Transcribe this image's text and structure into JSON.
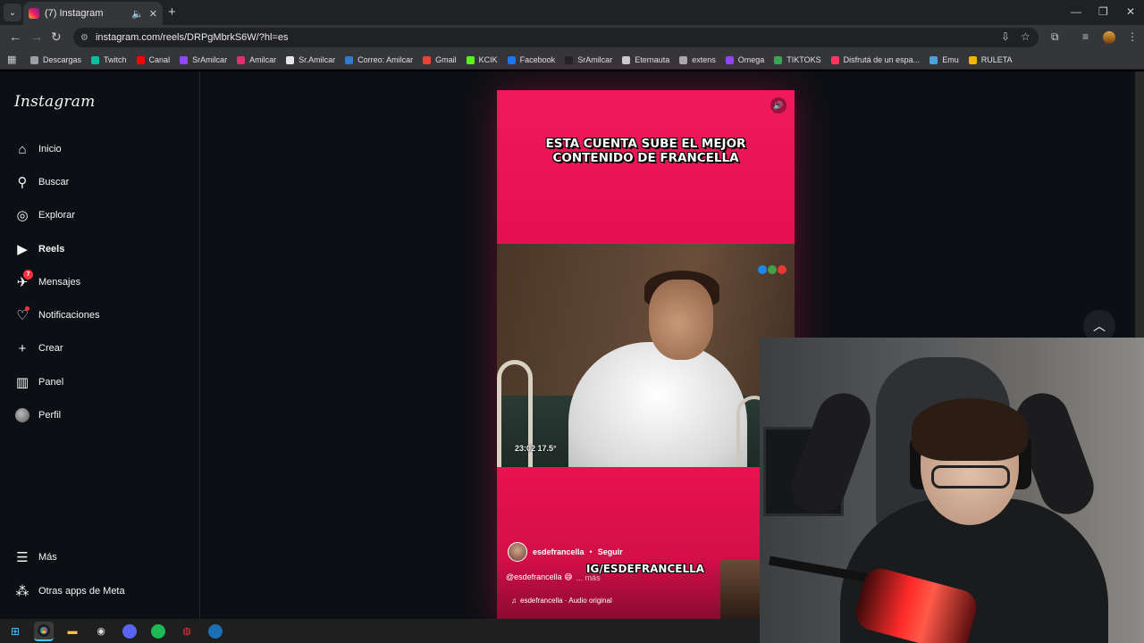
{
  "browser": {
    "tab_title": "(7) Instagram",
    "url": "instagram.com/reels/DRPgMbrkS6W/?hl=es",
    "bookmarks": [
      {
        "label": "Descargas",
        "icon": "download-icon",
        "color": "#9aa0a6"
      },
      {
        "label": "Twitch",
        "icon": "twitch-icon",
        "color": "#00c4a0"
      },
      {
        "label": "Canal",
        "icon": "youtube-icon",
        "color": "#ff0000"
      },
      {
        "label": "SrAmilcar",
        "icon": "twitch-icon",
        "color": "#9146ff"
      },
      {
        "label": "Amilcar",
        "icon": "instagram-icon",
        "color": "#e1306c"
      },
      {
        "label": "Sr.Amilcar",
        "icon": "x-icon",
        "color": "#e8e8e8"
      },
      {
        "label": "Correo: Amilcar",
        "icon": "outlook-icon",
        "color": "#2b7cd3"
      },
      {
        "label": "Gmail",
        "icon": "gmail-icon",
        "color": "#ea4335"
      },
      {
        "label": "KCIK",
        "icon": "kick-icon",
        "color": "#53fc18"
      },
      {
        "label": "Facebook",
        "icon": "facebook-icon",
        "color": "#1877f2"
      },
      {
        "label": "SrAmilcar",
        "icon": "tiktok-icon",
        "color": "#222222"
      },
      {
        "label": "Eternauta",
        "icon": "page-icon",
        "color": "#cccccc"
      },
      {
        "label": "extens",
        "icon": "extension-icon",
        "color": "#aaaaaa"
      },
      {
        "label": "Omega",
        "icon": "twitch-icon",
        "color": "#9146ff"
      },
      {
        "label": "TIKTOKS",
        "icon": "drive-icon",
        "color": "#34a853"
      },
      {
        "label": "Disfrutá de un espa...",
        "icon": "airbnb-icon",
        "color": "#ff385c"
      },
      {
        "label": "Emu",
        "icon": "emu-icon",
        "color": "#4aa3df"
      },
      {
        "label": "RULETA",
        "icon": "wheel-icon",
        "color": "#f4b400"
      }
    ]
  },
  "instagram": {
    "logo": "Instagram",
    "nav": [
      {
        "label": "Inicio",
        "icon": "home-icon"
      },
      {
        "label": "Buscar",
        "icon": "search-icon"
      },
      {
        "label": "Explorar",
        "icon": "compass-icon"
      },
      {
        "label": "Reels",
        "icon": "reels-icon",
        "active": true
      },
      {
        "label": "Mensajes",
        "icon": "messenger-icon",
        "badge": "7"
      },
      {
        "label": "Notificaciones",
        "icon": "heart-icon"
      },
      {
        "label": "Crear",
        "icon": "plus-icon"
      },
      {
        "label": "Panel",
        "icon": "chart-icon"
      },
      {
        "label": "Perfil",
        "icon": "profile-avatar-icon"
      }
    ],
    "more": {
      "label": "Más",
      "icon": "menu-icon"
    },
    "meta_apps": {
      "label": "Otras apps de Meta",
      "icon": "meta-apps-icon"
    }
  },
  "reel": {
    "caption_line1": "ESTA CUENTA SUBE EL MEJOR",
    "caption_line2": "CONTENIDO DE FRANCELLA",
    "timestamp": "23:02  17.5°",
    "watermark": "IG/ESDEFRANCELLA",
    "owner": "esdefrancella",
    "separator": "•",
    "follow_label": "Seguir",
    "description": "@esdefrancella 😅",
    "more_label": "... más",
    "audio": "esdefrancella · Audio original",
    "tv_logo_colors": [
      "#1e88e5",
      "#43a047",
      "#e53935"
    ]
  },
  "taskbar": {
    "apps": [
      "windows-icon",
      "chrome-icon",
      "file-explorer-icon",
      "obs-icon",
      "discord-icon",
      "spotify-icon",
      "recorder-icon",
      "steam-icon"
    ]
  },
  "colors": {
    "reel_pink": "#e8124f",
    "notification_red": "#ff3040",
    "page_bg": "#0c1014"
  }
}
